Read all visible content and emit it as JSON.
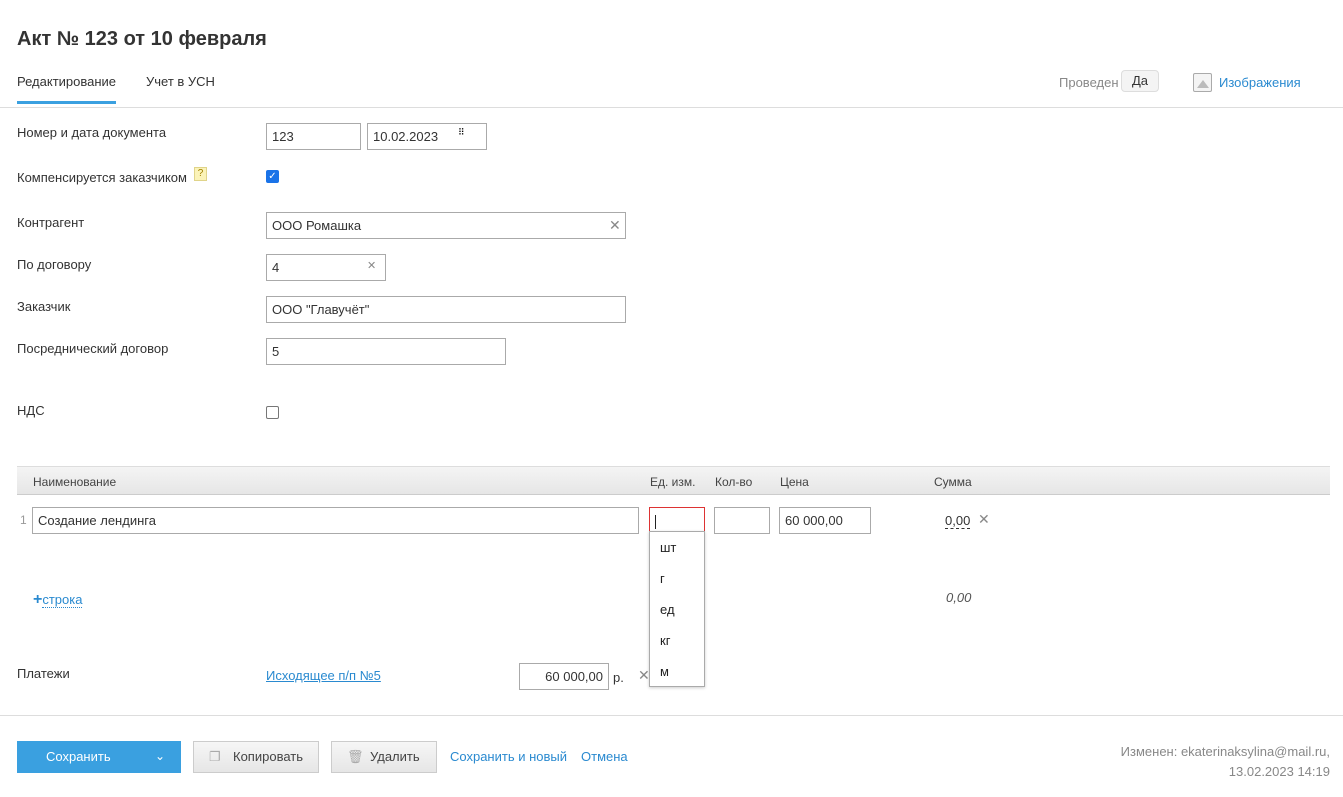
{
  "title": "Акт № 123 от 10 февраля",
  "tabs": [
    "Редактирование",
    "Учет в УСН"
  ],
  "status": {
    "label": "Проведен",
    "value": "Да"
  },
  "images_link": "Изображения",
  "form": {
    "number_date_label": "Номер и дата документа",
    "number": "123",
    "date": "10.02.2023",
    "compensated_label": "Компенсируется заказчиком",
    "help": "?",
    "counterparty_label": "Контрагент",
    "counterparty": "ООО Ромашка",
    "contract_label": "По договору",
    "contract": "4",
    "customer_label": "Заказчик",
    "customer": "ООО \"Главучёт\"",
    "agency_label": "Посреднический договор",
    "agency": "5",
    "vat_label": "НДС"
  },
  "table": {
    "headers": [
      "Наименование",
      "Ед. изм.",
      "Кол-во",
      "Цена",
      "Сумма"
    ],
    "rows": [
      {
        "num": "1",
        "name": "Создание лендинга",
        "unit": "",
        "qty": "",
        "price": "60 000,00",
        "sum": "0,00"
      }
    ],
    "add_row": "строка",
    "total": "0,00"
  },
  "unit_options": [
    "шт",
    "г",
    "ед",
    "кг",
    "м"
  ],
  "payments": {
    "label": "Платежи",
    "link": "Исходящее п/п №5",
    "amount": "60 000,00",
    "currency": "р."
  },
  "footer": {
    "save": "Сохранить",
    "copy": "Копировать",
    "delete": "Удалить",
    "save_new": "Сохранить и новый",
    "cancel": "Отмена",
    "modified": "Изменен: ekaterinaksylina@mail.ru,",
    "modified_date": "13.02.2023 14:19"
  }
}
